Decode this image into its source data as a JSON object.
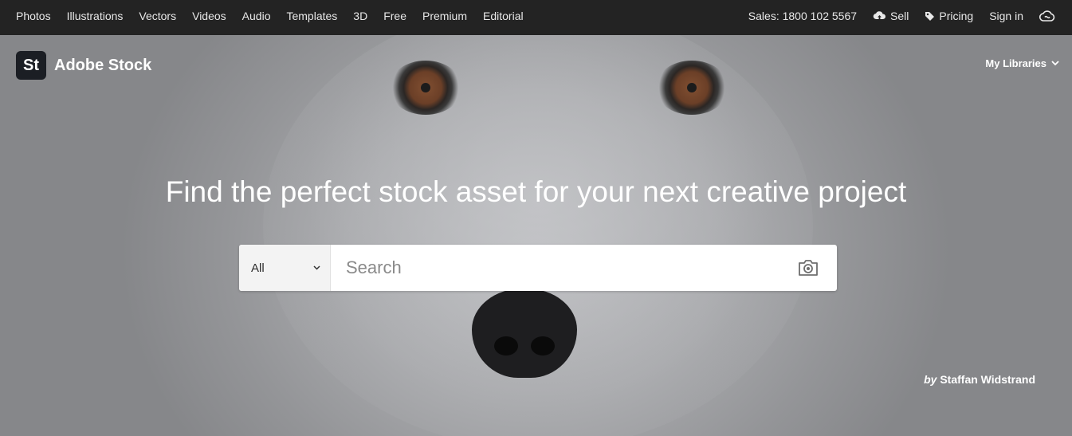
{
  "nav": {
    "left_items": [
      "Photos",
      "Illustrations",
      "Vectors",
      "Videos",
      "Audio",
      "Templates",
      "3D",
      "Free",
      "Premium",
      "Editorial"
    ],
    "sales": "Sales: 1800 102 5567",
    "sell": "Sell",
    "pricing": "Pricing",
    "sign_in": "Sign in"
  },
  "brand": {
    "badge": "St",
    "name": "Adobe Stock"
  },
  "my_libraries": "My Libraries",
  "hero": {
    "headline": "Find the perfect stock asset for your next creative project",
    "credit_prefix": "by",
    "credit_name": "Staffan Widstrand"
  },
  "search": {
    "filter_value": "All",
    "placeholder": "Search"
  },
  "icons": [
    "upload-cloud-icon",
    "tag-icon",
    "creative-cloud-icon",
    "chevron-down-icon",
    "camera-icon"
  ]
}
